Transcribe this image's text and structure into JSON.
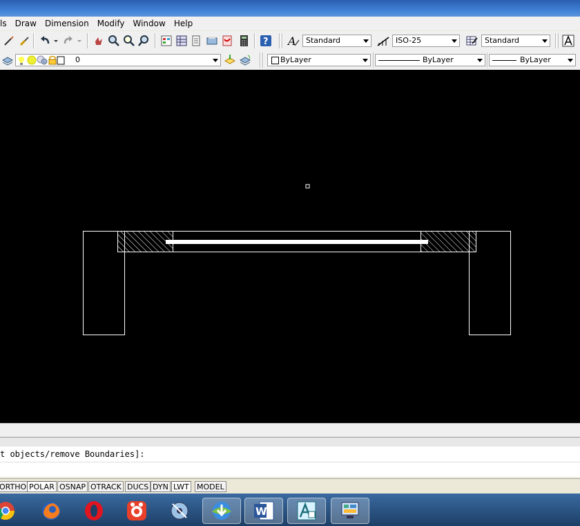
{
  "menu": [
    "ls",
    "Draw",
    "Dimension",
    "Modify",
    "Window",
    "Help"
  ],
  "toolbar1": {
    "text_style": "Standard",
    "dim_style": "ISO-25",
    "table_style": "Standard"
  },
  "toolbar2": {
    "layer": "0",
    "color": "ByLayer",
    "linetype": "ByLayer",
    "lineweight": "ByLayer"
  },
  "command": {
    "prompt": "t objects/remove Boundaries]:"
  },
  "status_buttons": [
    "ORTHO",
    "POLAR",
    "OSNAP",
    "OTRACK",
    "DUCS",
    "DYN",
    "LWT",
    "MODEL"
  ],
  "taskbar": [
    "chrome-icon",
    "firefox-icon",
    "opera-icon",
    "app-icon",
    "media-icon",
    "download-icon",
    "word-icon",
    "autocad-icon",
    "control-icon"
  ]
}
